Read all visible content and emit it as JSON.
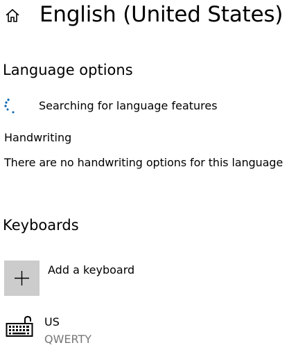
{
  "header": {
    "home_icon": "home-icon",
    "title": "English (United States)"
  },
  "language_options": {
    "title": "Language options",
    "searching_icon": "spinner-icon",
    "searching_text": "Searching for language features",
    "handwriting_label": "Handwriting",
    "handwriting_message": "There are no handwriting options for this language"
  },
  "keyboards": {
    "title": "Keyboards",
    "add_keyboard": {
      "icon": "plus-icon",
      "label": "Add a keyboard",
      "tile_color": "#cccccc"
    },
    "items": [
      {
        "icon": "keyboard-icon",
        "name": "US",
        "layout": "QWERTY"
      }
    ]
  },
  "colors": {
    "text": "#000000",
    "secondary_text": "#767676",
    "spinner": "#0063b1"
  }
}
